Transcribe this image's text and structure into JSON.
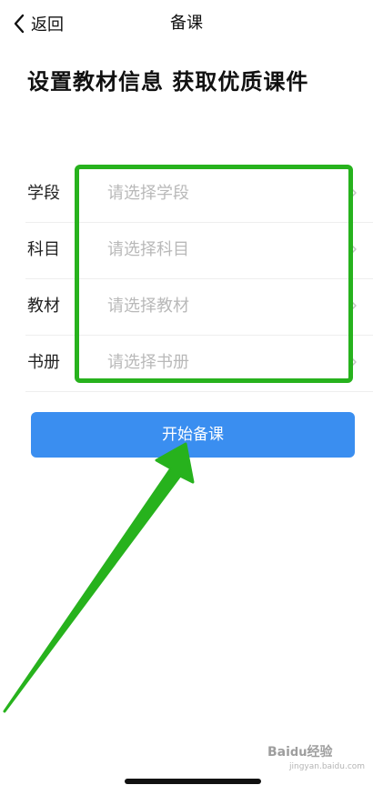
{
  "nav": {
    "back_label": "返回",
    "title": "备课"
  },
  "headline": "设置教材信息 获取优质课件",
  "form": {
    "rows": [
      {
        "label": "学段",
        "placeholder": "请选择学段"
      },
      {
        "label": "科目",
        "placeholder": "请选择科目"
      },
      {
        "label": "教材",
        "placeholder": "请选择教材"
      },
      {
        "label": "书册",
        "placeholder": "请选择书册"
      }
    ]
  },
  "start_button": {
    "label": "开始备课"
  },
  "watermark": {
    "main": "Bai",
    "paw": "du",
    "suffix": "经验",
    "sub": "jingyan.baidu.com"
  },
  "colors": {
    "accent_blue": "#3a8ef0",
    "annotation_green": "#27b21d",
    "placeholder_gray": "#b9b9b9"
  },
  "icons": {
    "back": "chevron-left-icon",
    "row_arrow": "chevron-right-icon",
    "annotation": "pointer-arrow-icon"
  }
}
